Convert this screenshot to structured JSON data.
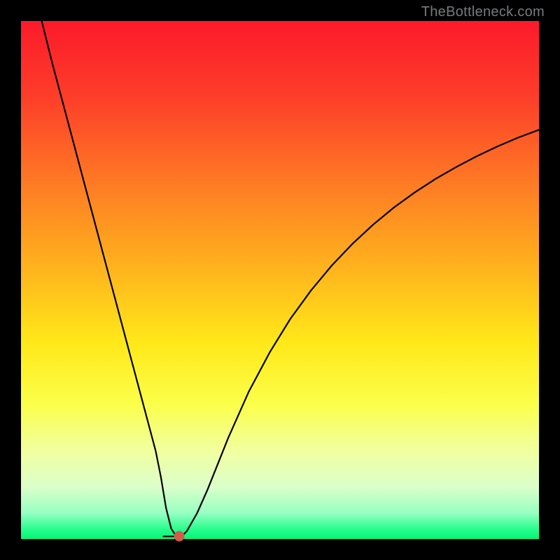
{
  "watermark": {
    "text": "TheBottleneck.com"
  },
  "chart_data": {
    "type": "line",
    "title": "",
    "xlabel": "",
    "ylabel": "",
    "xlim": [
      0,
      100
    ],
    "ylim": [
      0,
      100
    ],
    "series": [
      {
        "name": "curve",
        "x": [
          4,
          6,
          8,
          10,
          12,
          14,
          16,
          18,
          20,
          22,
          24,
          26,
          27,
          27.5,
          28,
          29,
          30,
          31,
          32,
          34,
          36,
          38,
          40,
          44,
          48,
          52,
          56,
          60,
          64,
          68,
          72,
          76,
          80,
          84,
          88,
          92,
          96,
          100
        ],
        "y": [
          100,
          92,
          84.5,
          77,
          69.5,
          62,
          54.5,
          47,
          39.5,
          32,
          24.5,
          17,
          12,
          9,
          6,
          2,
          0.5,
          0.5,
          1.5,
          5,
          9.5,
          14.5,
          19.5,
          28.5,
          36,
          42.5,
          48,
          52.8,
          57,
          60.7,
          64,
          66.9,
          69.5,
          71.8,
          73.9,
          75.8,
          77.5,
          79
        ]
      }
    ],
    "annotations": [
      {
        "name": "min-dot",
        "x": 30.5,
        "y": 0.5
      }
    ],
    "extras": {
      "flat_segment": {
        "x1": 27.5,
        "x2": 30,
        "y": 0.5
      }
    }
  }
}
